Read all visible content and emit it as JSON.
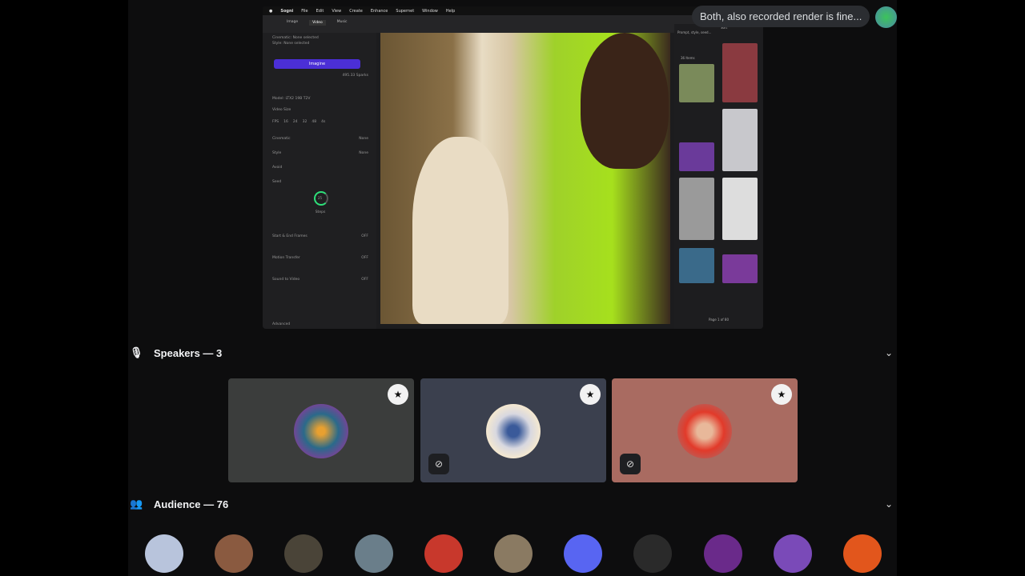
{
  "shared_screen": {
    "menubar": [
      "Sogni",
      "File",
      "Edit",
      "View",
      "Create",
      "Enhance",
      "Supernet",
      "Window",
      "Help"
    ],
    "tabs": [
      "Image",
      "Video",
      "Music"
    ],
    "left_panel": {
      "cinematic_line": "Cinematic: None selected",
      "style_line": "Style: None selected",
      "imagine_label": "Imagine",
      "sparks": "495.33 Sparks",
      "model": "Model: LTX2 19B T2V",
      "video_size": "Video Size",
      "fps_label": "FPS",
      "fps_options": [
        "16",
        "24",
        "32",
        "48"
      ],
      "duration": "4s",
      "sections": [
        {
          "label": "Cinematic",
          "value": "None"
        },
        {
          "label": "Style",
          "value": "None"
        },
        {
          "label": "Avoid",
          "value": ""
        },
        {
          "label": "Seed",
          "value": ""
        }
      ],
      "steps_value": "25",
      "steps_label": "Steps",
      "toggles": [
        {
          "label": "Start & End Frames",
          "value": "OFF"
        },
        {
          "label": "Motion Transfer",
          "value": "OFF"
        },
        {
          "label": "Sound to Video",
          "value": "OFF"
        }
      ],
      "advanced": "Advanced"
    },
    "right_panel": {
      "search_placeholder": "Prompt, style, seed...",
      "sort_label": "Sort",
      "items_count": "36 Items",
      "pagination": "Page 1 of 80"
    }
  },
  "tooltip": {
    "text": "Both, also recorded render is fine..."
  },
  "speakers": {
    "label": "Speakers — 3",
    "tiles": [
      {
        "bg": "#3b3d3c",
        "avatar": "owl",
        "muted": false
      },
      {
        "bg": "#3b404e",
        "avatar": "glowing-figure",
        "muted": true
      },
      {
        "bg": "#a96b61",
        "avatar": "pixel-punk",
        "muted": true
      }
    ]
  },
  "audience": {
    "label": "Audience — 76",
    "avatars": [
      "#b8c4dc",
      "#8a5a40",
      "#4a4438",
      "#6a7e8a",
      "#c8382c",
      "#8a7a62",
      "#5865f2",
      "#2a2a2a",
      "#6a2a8a",
      "#7a4ab8",
      "#e2561c"
    ]
  }
}
